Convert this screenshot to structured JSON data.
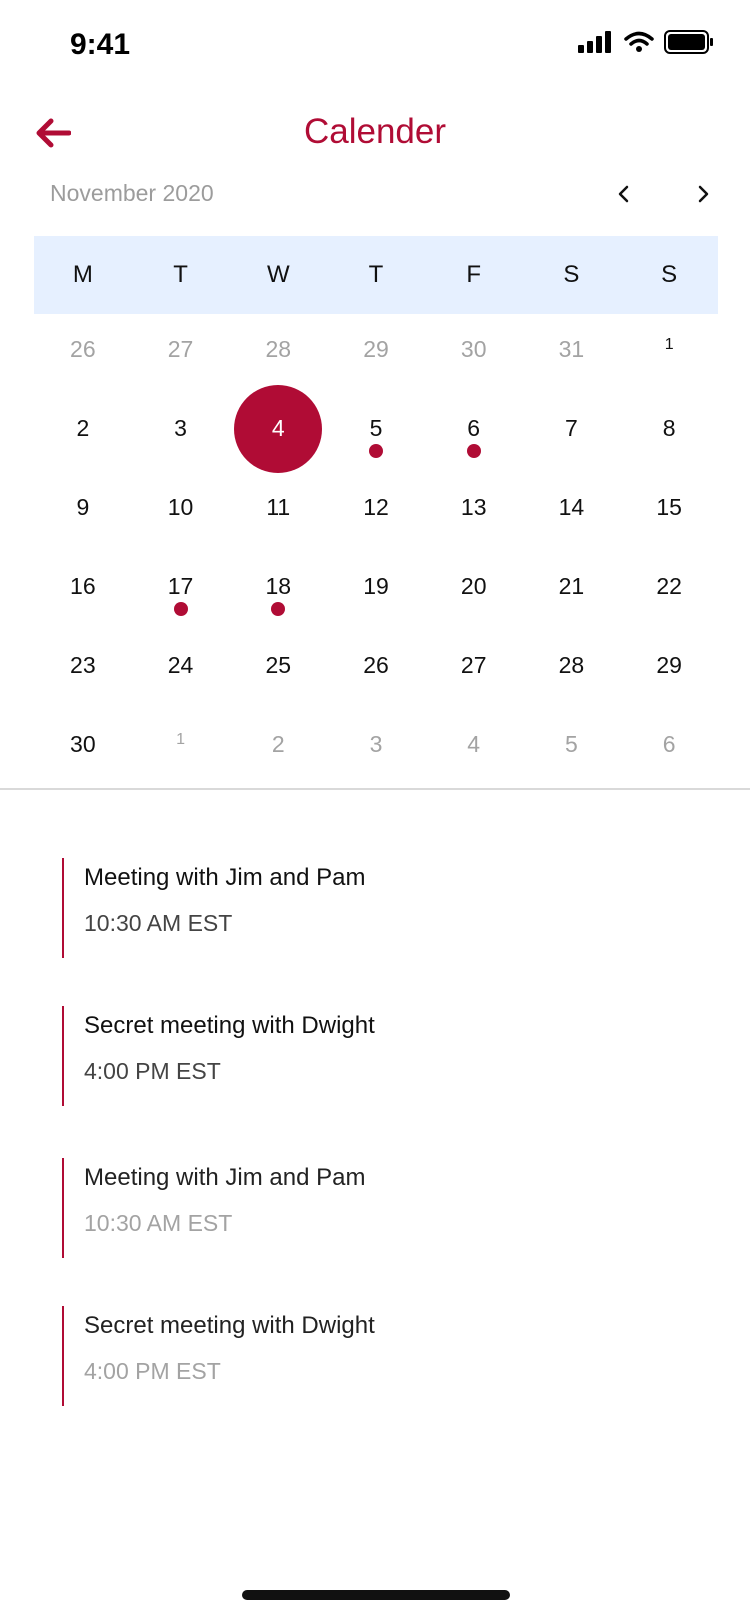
{
  "status_bar": {
    "time": "9:41"
  },
  "header": {
    "title": "Calender"
  },
  "month_nav": {
    "label": "November 2020"
  },
  "weekdays": [
    "M",
    "T",
    "W",
    "T",
    "F",
    "S",
    "S"
  ],
  "days": [
    {
      "label": "26",
      "muted": true
    },
    {
      "label": "27",
      "muted": true
    },
    {
      "label": "28",
      "muted": true
    },
    {
      "label": "29",
      "muted": true
    },
    {
      "label": "30",
      "muted": true
    },
    {
      "label": "31",
      "muted": true
    },
    {
      "label": "1",
      "small": true
    },
    {
      "label": "2"
    },
    {
      "label": "3"
    },
    {
      "label": "4",
      "selected": true
    },
    {
      "label": "5",
      "event": true
    },
    {
      "label": "6",
      "event": true
    },
    {
      "label": "7"
    },
    {
      "label": "8"
    },
    {
      "label": "9"
    },
    {
      "label": "10"
    },
    {
      "label": "11"
    },
    {
      "label": "12"
    },
    {
      "label": "13"
    },
    {
      "label": "14"
    },
    {
      "label": "15"
    },
    {
      "label": "16"
    },
    {
      "label": "17",
      "event": true
    },
    {
      "label": "18",
      "event": true
    },
    {
      "label": "19"
    },
    {
      "label": "20"
    },
    {
      "label": "21"
    },
    {
      "label": "22"
    },
    {
      "label": "23"
    },
    {
      "label": "24"
    },
    {
      "label": "25"
    },
    {
      "label": "26"
    },
    {
      "label": "27"
    },
    {
      "label": "28"
    },
    {
      "label": "29"
    },
    {
      "label": "30"
    },
    {
      "label": "1",
      "muted": true,
      "small": true
    },
    {
      "label": "2",
      "muted": true
    },
    {
      "label": "3",
      "muted": true
    },
    {
      "label": "4",
      "muted": true
    },
    {
      "label": "5",
      "muted": true
    },
    {
      "label": "6",
      "muted": true
    }
  ],
  "events": [
    {
      "title": "Meeting with Jim and Pam",
      "time": "10:30 AM EST",
      "style": "bold"
    },
    {
      "title": "Secret meeting with Dwight",
      "time": "4:00 PM EST",
      "style": "bold"
    },
    {
      "title": "Meeting with Jim and Pam",
      "time": "10:30 AM EST",
      "style": "light"
    },
    {
      "title": "Secret meeting with Dwight",
      "time": "4:00 PM EST",
      "style": "light"
    }
  ],
  "icons": {
    "back": "arrow-left-icon",
    "prev": "chevron-left-icon",
    "next": "chevron-right-icon",
    "signal": "cellular-signal-icon",
    "wifi": "wifi-icon",
    "battery": "battery-icon"
  },
  "colors": {
    "accent": "#b00c35",
    "weekday_bar": "#e6f0ff",
    "muted_text": "#a3a3a3"
  }
}
